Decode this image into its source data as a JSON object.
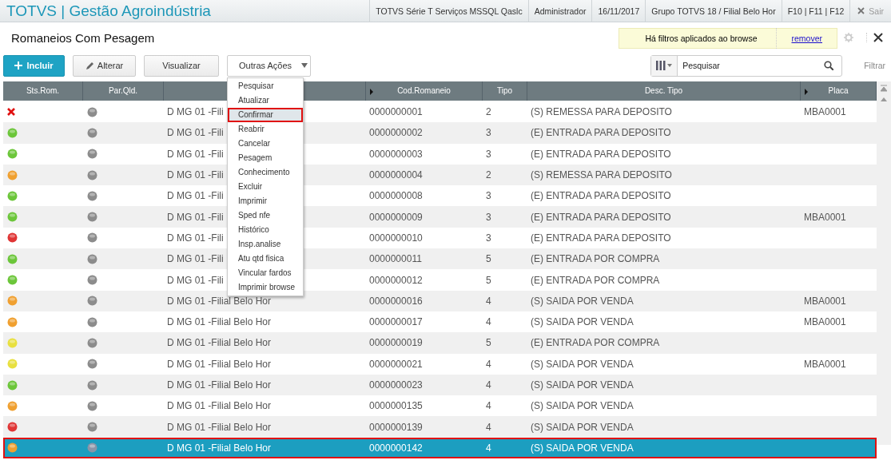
{
  "app": {
    "title": "TOTVS | Gestão Agroindústria",
    "info": [
      "TOTVS Série T Serviços MSSQL Qaslc",
      "Administrador",
      "16/11/2017",
      "Grupo TOTVS 18 / Filial Belo Hor",
      "F10 | F11 | F12"
    ],
    "exit": "Sair"
  },
  "page": {
    "title": "Romaneios Com Pesagem",
    "filter_notice": "Há filtros aplicados ao browse",
    "filter_remove": "remover"
  },
  "toolbar": {
    "buttons": [
      {
        "kind": "primary",
        "label": "Incluir"
      },
      {
        "kind": "edit",
        "label": "Alterar"
      },
      {
        "kind": "plain",
        "label": "Visualizar"
      },
      {
        "kind": "dropdown",
        "label": "Outras Ações"
      }
    ],
    "search": {
      "placeholder": "Pesquisar"
    },
    "filter": "Filtrar"
  },
  "menu": {
    "items": [
      {
        "label": "Pesquisar",
        "selected": false
      },
      {
        "label": "Atualizar",
        "selected": false
      },
      {
        "label": "Confirmar",
        "selected": true
      },
      {
        "label": "Reabrir",
        "selected": false
      },
      {
        "label": "Cancelar",
        "selected": false
      },
      {
        "label": "Pesagem",
        "selected": false
      },
      {
        "label": "Conhecimento",
        "selected": false
      },
      {
        "label": "Excluir",
        "selected": false
      },
      {
        "label": "Imprimir",
        "selected": false
      },
      {
        "label": "Sped nfe",
        "selected": false
      },
      {
        "label": "Histórico",
        "selected": false
      },
      {
        "label": "Insp.analise",
        "selected": false
      },
      {
        "label": "Atu qtd fisica",
        "selected": false
      },
      {
        "label": "Vincular fardos",
        "selected": false
      },
      {
        "label": "Imprimir browse",
        "selected": false
      }
    ]
  },
  "table": {
    "columns": [
      {
        "label": "Sts.Rom.",
        "sortable": false
      },
      {
        "label": "Par.Qld.",
        "sortable": false
      },
      {
        "sortable": false
      },
      {
        "label": "Cod.Romaneio",
        "sortable": true
      },
      {
        "label": "Tipo",
        "sortable": false
      },
      {
        "label": "Desc. Tipo",
        "sortable": false
      },
      {
        "label": "Placa",
        "sortable": true
      }
    ],
    "rows": [
      {
        "status": {
          "kind": "cross"
        },
        "filial": "D MG 01 -Fili",
        "cod": "0000000001",
        "tipo": "2",
        "desc": "(S) REMESSA PARA DEPOSITO",
        "placa": "MBA0001",
        "selected": false
      },
      {
        "status": {
          "kind": "dot",
          "color": "#6cc63a"
        },
        "filial": "D MG 01 -Fili",
        "cod": "0000000002",
        "tipo": "3",
        "desc": "(E) ENTRADA PARA DEPOSITO",
        "selected": false
      },
      {
        "status": {
          "kind": "dot",
          "color": "#6cc63a"
        },
        "filial": "D MG 01 -Fili",
        "cod": "0000000003",
        "tipo": "3",
        "desc": "(E) ENTRADA PARA DEPOSITO",
        "selected": false
      },
      {
        "status": {
          "kind": "dot",
          "color": "#f0a030"
        },
        "filial": "D MG 01 -Fili",
        "cod": "0000000004",
        "tipo": "2",
        "desc": "(S) REMESSA PARA DEPOSITO",
        "selected": false
      },
      {
        "status": {
          "kind": "dot",
          "color": "#6cc63a"
        },
        "filial": "D MG 01 -Fili",
        "cod": "0000000008",
        "tipo": "3",
        "desc": "(E) ENTRADA PARA DEPOSITO",
        "selected": false
      },
      {
        "status": {
          "kind": "dot",
          "color": "#6cc63a"
        },
        "filial": "D MG 01 -Fili",
        "cod": "0000000009",
        "tipo": "3",
        "desc": "(E) ENTRADA PARA DEPOSITO",
        "placa": "MBA0001",
        "selected": false
      },
      {
        "status": {
          "kind": "dot",
          "color": "#e03535"
        },
        "filial": "D MG 01 -Fili",
        "cod": "0000000010",
        "tipo": "3",
        "desc": "(E) ENTRADA PARA DEPOSITO",
        "selected": false
      },
      {
        "status": {
          "kind": "dot",
          "color": "#6cc63a"
        },
        "filial": "D MG 01 -Fili",
        "cod": "0000000011",
        "tipo": "5",
        "desc": "(E) ENTRADA POR COMPRA",
        "selected": false
      },
      {
        "status": {
          "kind": "dot",
          "color": "#6cc63a"
        },
        "filial": "D MG 01 -Fili",
        "cod": "0000000012",
        "tipo": "5",
        "desc": "(E) ENTRADA POR COMPRA",
        "selected": false
      },
      {
        "status": {
          "kind": "dot",
          "color": "#f0a030"
        },
        "filial": "D MG 01 -Filial Belo Hor",
        "cod": "0000000016",
        "tipo": "4",
        "desc": "(S) SAIDA POR VENDA",
        "placa": "MBA0001",
        "selected": false
      },
      {
        "status": {
          "kind": "dot",
          "color": "#f0a030"
        },
        "filial": "D MG 01 -Filial Belo Hor",
        "cod": "0000000017",
        "tipo": "4",
        "desc": "(S) SAIDA POR VENDA",
        "placa": "MBA0001",
        "selected": false
      },
      {
        "status": {
          "kind": "dot",
          "color": "#e8e040"
        },
        "filial": "D MG 01 -Filial Belo Hor",
        "cod": "0000000019",
        "tipo": "5",
        "desc": "(E) ENTRADA POR COMPRA",
        "selected": false
      },
      {
        "status": {
          "kind": "dot",
          "color": "#e8e040"
        },
        "filial": "D MG 01 -Filial Belo Hor",
        "cod": "0000000021",
        "tipo": "4",
        "desc": "(S) SAIDA POR VENDA",
        "placa": "MBA0001",
        "selected": false
      },
      {
        "status": {
          "kind": "dot",
          "color": "#6cc63a"
        },
        "filial": "D MG 01 -Filial Belo Hor",
        "cod": "0000000023",
        "tipo": "4",
        "desc": "(S) SAIDA POR VENDA",
        "selected": false
      },
      {
        "status": {
          "kind": "dot",
          "color": "#f0a030"
        },
        "filial": "D MG 01 -Filial Belo Hor",
        "cod": "0000000135",
        "tipo": "4",
        "desc": "(S) SAIDA POR VENDA",
        "selected": false
      },
      {
        "status": {
          "kind": "dot",
          "color": "#e03535"
        },
        "filial": "D MG 01 -Filial Belo Hor",
        "cod": "0000000139",
        "tipo": "4",
        "desc": "(S) SAIDA POR VENDA",
        "selected": false
      },
      {
        "status": {
          "kind": "dot",
          "color": "#f0a030"
        },
        "filial": "D MG 01 -Filial Belo Hor",
        "cod": "0000000142",
        "tipo": "4",
        "desc": "(S) SAIDA POR VENDA",
        "selected": true
      }
    ]
  }
}
